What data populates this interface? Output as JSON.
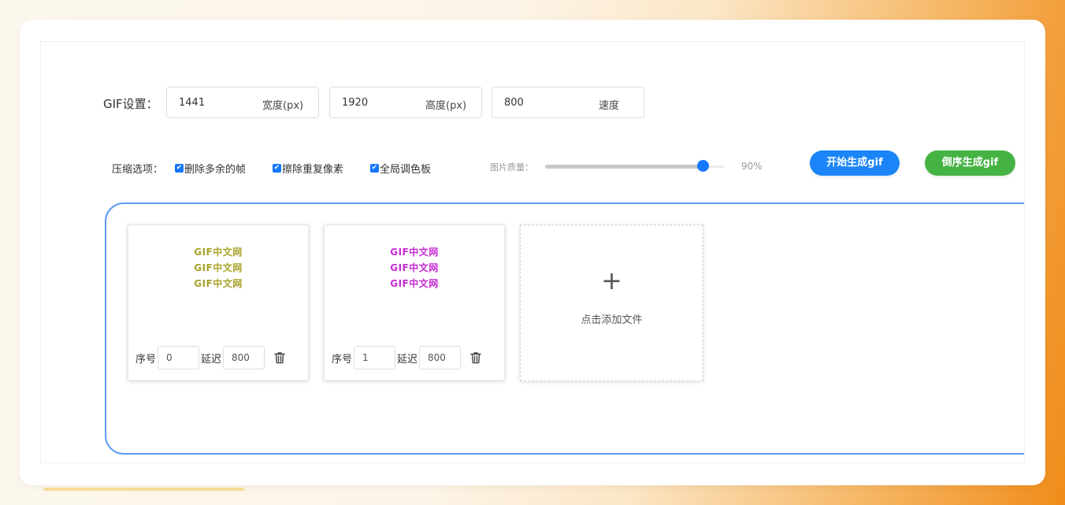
{
  "settings": {
    "label": "GIF设置：",
    "width_value": "1441",
    "width_suffix": "宽度(px)",
    "height_value": "1920",
    "height_suffix": "高度(px)",
    "speed_value": "800",
    "speed_suffix": "速度"
  },
  "compression": {
    "label": "压缩选项：",
    "options": [
      {
        "label": "删除多余的帧",
        "checked": true
      },
      {
        "label": "擦除重复像素",
        "checked": true
      },
      {
        "label": "全局调色板",
        "checked": true
      }
    ]
  },
  "quality": {
    "label": "图片质量：",
    "value": 0.9,
    "value_text": "90%"
  },
  "buttons": {
    "start": "开始生成gif",
    "reverse": "倒序生成gif"
  },
  "frames": [
    {
      "preview_lines": [
        "GIF中文网",
        "GIF中文网",
        "GIF中文网"
      ],
      "preview_color": "#a7a229",
      "order_label": "序号",
      "order": "0",
      "delay_label": "延迟",
      "delay": "800"
    },
    {
      "preview_lines": [
        "GIF中文网",
        "GIF中文网",
        "GIF中文网"
      ],
      "preview_color": "#c42bd2",
      "order_label": "序号",
      "order": "1",
      "delay_label": "延迟",
      "delay": "800"
    }
  ],
  "add_file": {
    "icon": "plus-icon",
    "label": "点击添加文件"
  },
  "colors": {
    "primary": "#1b85f8",
    "success": "#45b343",
    "danger": "#f0544a",
    "drop_border": "#5b9cf2"
  }
}
